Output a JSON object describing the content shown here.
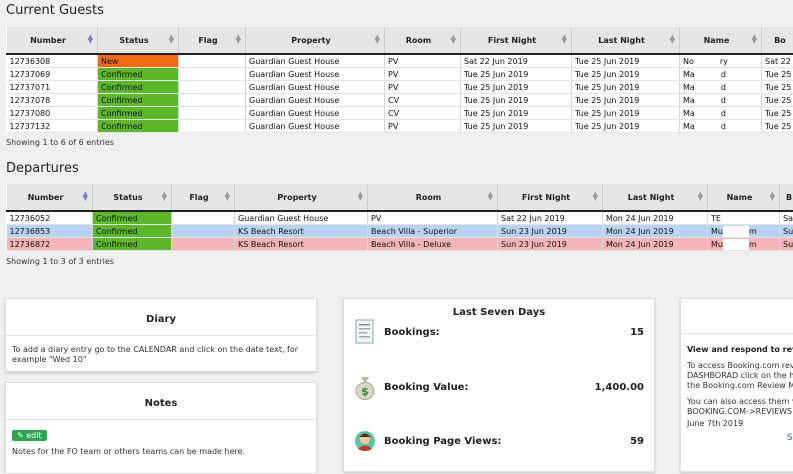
{
  "current_guests": {
    "title": "Current Guests",
    "columns": [
      "Number",
      "Status",
      "Flag",
      "Property",
      "Room",
      "First Night",
      "Last Night",
      "Name",
      "Bo"
    ],
    "rows": [
      {
        "number": "12736308",
        "status": "New",
        "flag": "",
        "property": "Guardian Guest House",
        "room": "PV",
        "first_night": "Sat 22 Jun 2019",
        "last_night": "Tue 25 Jun 2019",
        "name": "No",
        "name_tail": "ry",
        "bo": "Sat 22"
      },
      {
        "number": "12737069",
        "status": "Confirmed",
        "flag": "",
        "property": "Guardian Guest House",
        "room": "PV",
        "first_night": "Tue 25 Jun 2019",
        "last_night": "Tue 25 Jun 2019",
        "name": "Ma",
        "name_tail": "d",
        "bo": "Tue 25"
      },
      {
        "number": "12737071",
        "status": "Confirmed",
        "flag": "",
        "property": "Guardian Guest House",
        "room": "PV",
        "first_night": "Tue 25 Jun 2019",
        "last_night": "Tue 25 Jun 2019",
        "name": "Ma",
        "name_tail": "d",
        "bo": "Tue 25"
      },
      {
        "number": "12737078",
        "status": "Confirmed",
        "flag": "",
        "property": "Guardian Guest House",
        "room": "CV",
        "first_night": "Tue 25 Jun 2019",
        "last_night": "Tue 25 Jun 2019",
        "name": "Ma",
        "name_tail": "d",
        "bo": "Tue 25"
      },
      {
        "number": "12737080",
        "status": "Confirmed",
        "flag": "",
        "property": "Guardian Guest House",
        "room": "CV",
        "first_night": "Tue 25 Jun 2019",
        "last_night": "Tue 25 Jun 2019",
        "name": "Ma",
        "name_tail": "d",
        "bo": "Tue 25"
      },
      {
        "number": "12737132",
        "status": "Confirmed",
        "flag": "",
        "property": "Guardian Guest House",
        "room": "PV",
        "first_night": "Tue 25 Jun 2019",
        "last_night": "Tue 25 Jun 2019",
        "name": "Ma",
        "name_tail": "d",
        "bo": "Tue 25"
      }
    ],
    "footer": "Showing 1 to 6 of 6 entries"
  },
  "departures": {
    "title": "Departures",
    "columns": [
      "Number",
      "Status",
      "Flag",
      "Property",
      "Room",
      "First Night",
      "Last Night",
      "Name",
      "B"
    ],
    "rows": [
      {
        "number": "12736052",
        "status": "Confirmed",
        "flag": "",
        "property": "Guardian Guest House",
        "room": "PV",
        "first_night": "Sat 22 Jun 2019",
        "last_night": "Mon 24 Jun 2019",
        "name": "TE",
        "name_tail": "",
        "bo": "Sa",
        "style": "white"
      },
      {
        "number": "12736853",
        "status": "Confirmed",
        "flag": "",
        "property": "KS Beach Resort",
        "room": "Beach Villa - Superior",
        "first_night": "Sun 23 Jun 2019",
        "last_night": "Mon 24 Jun 2019",
        "name": "Mu",
        "name_tail": "m",
        "bo": "Su",
        "style": "blue"
      },
      {
        "number": "12736872",
        "status": "Confirmed",
        "flag": "",
        "property": "KS Beach Resort",
        "room": "Beach Villa - Deluxe",
        "first_night": "Sun 23 Jun 2019",
        "last_night": "Mon 24 Jun 2019",
        "name": "Mu",
        "name_tail": "m",
        "bo": "Su",
        "style": "pink"
      }
    ],
    "footer": "Showing 1 to 3 of 3 entries"
  },
  "diary": {
    "title": "Diary",
    "text": "To add a diary entry go to the CALENDAR and click on the date text, for example \"Wed 10\""
  },
  "notes": {
    "title": "Notes",
    "edit_label": "edit",
    "text": "Notes for the FO team or others teams can be made here."
  },
  "last_seven_days": {
    "title": "Last Seven Days",
    "bookings_label": "Bookings:",
    "bookings_value": "15",
    "booking_value_label": "Booking Value:",
    "booking_value_value": "1,400.00",
    "page_views_label": "Booking Page Views:",
    "page_views_value": "59"
  },
  "reviews": {
    "heading": "View and respond to rev",
    "line1": "To access Booking.com revi",
    "line2": "DASHBORAD click on the ha",
    "line3": "the Booking.com Review Me",
    "line4": "You can also access them v",
    "line5": "BOOKING.COM->REVIEWS.",
    "date": "June 7th 2019",
    "link": "Se"
  },
  "colors": {
    "new": "#f06a14",
    "confirmed": "#5cb82a",
    "row_blue": "#b9d3f5",
    "row_pink": "#f4b5b8",
    "edit_button": "#2ea44f"
  }
}
